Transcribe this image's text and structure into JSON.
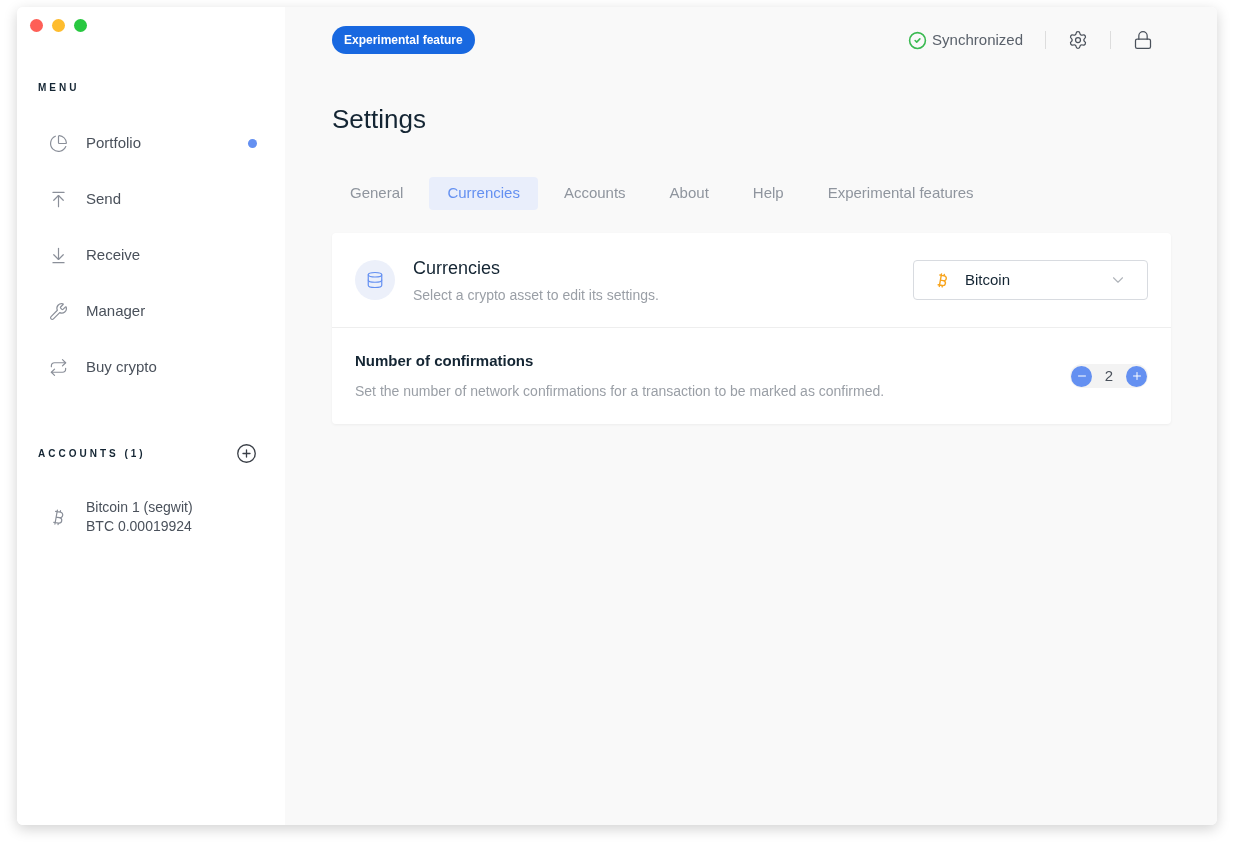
{
  "sidebar": {
    "menu_heading": "MENU",
    "items": [
      {
        "label": "Portfolio",
        "selected": false,
        "notification": true
      },
      {
        "label": "Send",
        "selected": false,
        "notification": false
      },
      {
        "label": "Receive",
        "selected": false,
        "notification": false
      },
      {
        "label": "Manager",
        "selected": false,
        "notification": false
      },
      {
        "label": "Buy crypto",
        "selected": false,
        "notification": false
      }
    ],
    "accounts_heading": "ACCOUNTS (1)",
    "accounts": [
      {
        "name": "Bitcoin 1 (segwit)",
        "balance": "BTC 0.00019924"
      }
    ]
  },
  "top_bar": {
    "badge": "Experimental feature",
    "sync_status": "Synchronized"
  },
  "title": "Settings",
  "tabs": [
    {
      "label": "General",
      "selected": false
    },
    {
      "label": "Currencies",
      "selected": true
    },
    {
      "label": "Accounts",
      "selected": false
    },
    {
      "label": "About",
      "selected": false
    },
    {
      "label": "Help",
      "selected": false
    },
    {
      "label": "Experimental features",
      "selected": false
    }
  ],
  "card": {
    "title": "Currencies",
    "subtitle": "Select a crypto asset to edit its settings.",
    "currency_select": {
      "value": "Bitcoin"
    },
    "rows": [
      {
        "title": "Number of confirmations",
        "description": "Set the number of network confirmations for a transaction to be marked as confirmed.",
        "value": "2"
      }
    ]
  }
}
